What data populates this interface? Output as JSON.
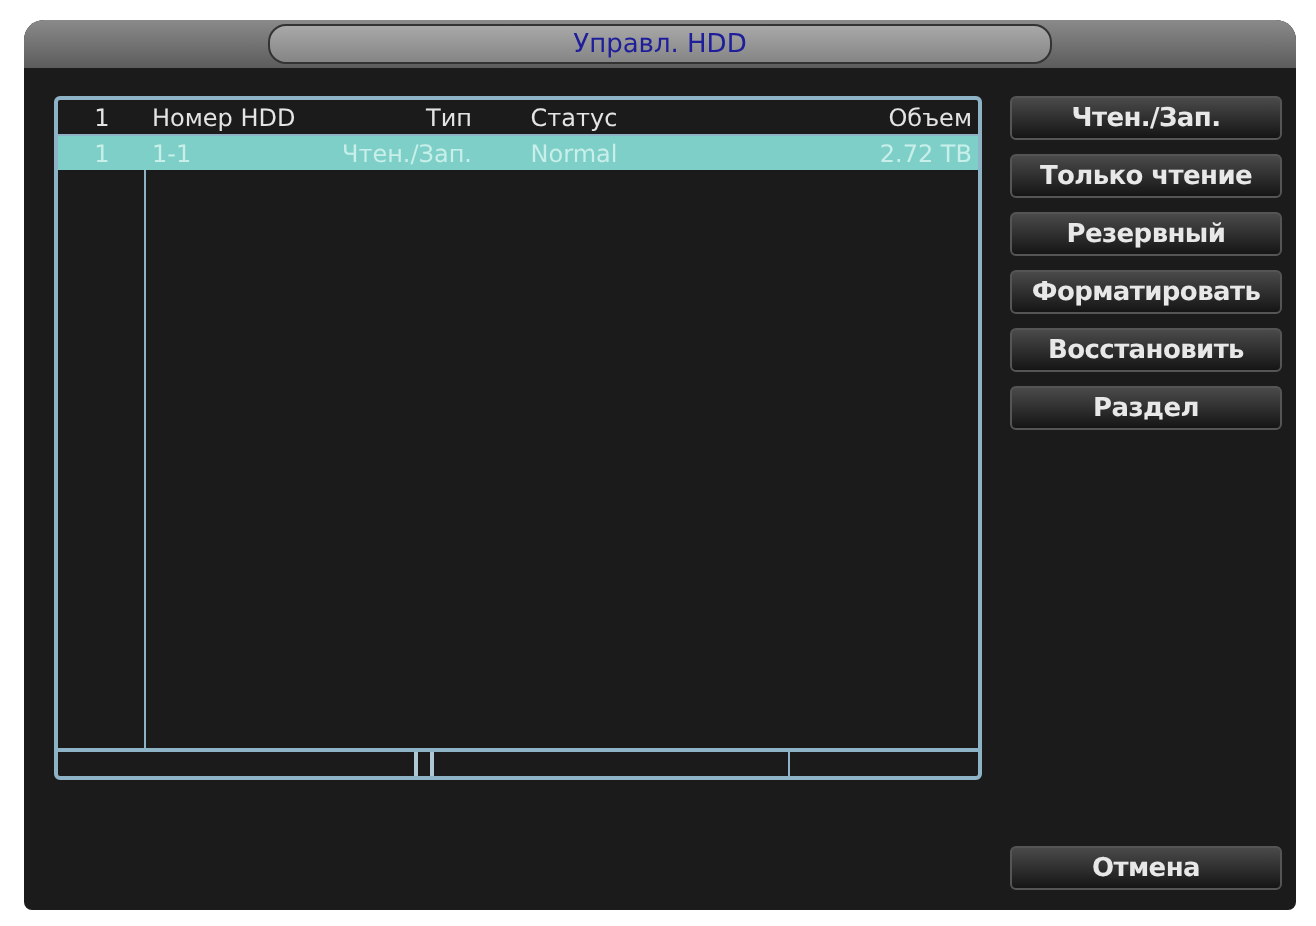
{
  "window": {
    "title": "Управл. HDD"
  },
  "table": {
    "columns": [
      "1",
      "Номер HDD",
      "Тип",
      "Статус",
      "Объем"
    ],
    "rows": [
      {
        "cells": [
          "1",
          "1-1",
          "Чтен./Зап.",
          "Normal",
          "2.72 TB"
        ],
        "selected": true
      }
    ]
  },
  "buttons": [
    "Чтен./Зап.",
    "Только чтение",
    "Резервный",
    "Форматировать",
    "Восстановить",
    "Раздел"
  ],
  "cancel_button": "Отмена"
}
